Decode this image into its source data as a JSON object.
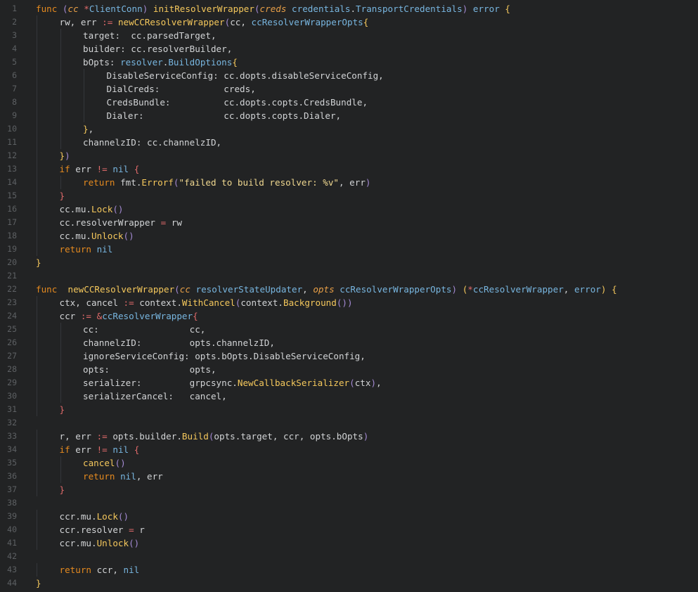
{
  "editor": {
    "lines": [
      {
        "n": "1",
        "indent": 0,
        "tokens": [
          [
            "kw",
            "func "
          ],
          [
            "br",
            "("
          ],
          [
            "param",
            "cc "
          ],
          [
            "op",
            "*"
          ],
          [
            "ty",
            "ClientConn"
          ],
          [
            "br",
            ")"
          ],
          [
            "pl",
            " "
          ],
          [
            "fn",
            "initResolverWrapper"
          ],
          [
            "br",
            "("
          ],
          [
            "param",
            "creds "
          ],
          [
            "ty",
            "credentials"
          ],
          [
            "pl",
            "."
          ],
          [
            "ty",
            "TransportCredentials"
          ],
          [
            "br",
            ")"
          ],
          [
            "pl",
            " "
          ],
          [
            "ty",
            "error"
          ],
          [
            "pl",
            " "
          ],
          [
            "fn",
            "{"
          ]
        ]
      },
      {
        "n": "2",
        "indent": 1,
        "tokens": [
          [
            "pl",
            "rw, err "
          ],
          [
            "op",
            ":="
          ],
          [
            "pl",
            " "
          ],
          [
            "fn",
            "newCCResolverWrapper"
          ],
          [
            "br",
            "("
          ],
          [
            "pl",
            "cc, "
          ],
          [
            "ty",
            "ccResolverWrapperOpts"
          ],
          [
            "fn",
            "{"
          ]
        ]
      },
      {
        "n": "3",
        "indent": 2,
        "tokens": [
          [
            "pl",
            "target:  cc.parsedTarget,"
          ]
        ]
      },
      {
        "n": "4",
        "indent": 2,
        "tokens": [
          [
            "pl",
            "builder: cc.resolverBuilder,"
          ]
        ]
      },
      {
        "n": "5",
        "indent": 2,
        "tokens": [
          [
            "pl",
            "bOpts: "
          ],
          [
            "ty",
            "resolver"
          ],
          [
            "pl",
            "."
          ],
          [
            "ty",
            "BuildOptions"
          ],
          [
            "fn",
            "{"
          ]
        ]
      },
      {
        "n": "6",
        "indent": 3,
        "tokens": [
          [
            "pl",
            "DisableServiceConfig: cc.dopts.disableServiceConfig,"
          ]
        ]
      },
      {
        "n": "7",
        "indent": 3,
        "tokens": [
          [
            "pl",
            "DialCreds:            creds,"
          ]
        ]
      },
      {
        "n": "8",
        "indent": 3,
        "tokens": [
          [
            "pl",
            "CredsBundle:          cc.dopts.copts.CredsBundle,"
          ]
        ]
      },
      {
        "n": "9",
        "indent": 3,
        "tokens": [
          [
            "pl",
            "Dialer:               cc.dopts.copts.Dialer,"
          ]
        ]
      },
      {
        "n": "10",
        "indent": 2,
        "tokens": [
          [
            "fn",
            "}"
          ],
          [
            "pl",
            ","
          ]
        ]
      },
      {
        "n": "11",
        "indent": 2,
        "tokens": [
          [
            "pl",
            "channelzID: cc.channelzID,"
          ]
        ]
      },
      {
        "n": "12",
        "indent": 1,
        "tokens": [
          [
            "fn",
            "}"
          ],
          [
            "br",
            ")"
          ]
        ]
      },
      {
        "n": "13",
        "indent": 1,
        "tokens": [
          [
            "kw",
            "if"
          ],
          [
            "pl",
            " err "
          ],
          [
            "op",
            "!="
          ],
          [
            "pl",
            " "
          ],
          [
            "ty",
            "nil"
          ],
          [
            "pl",
            " "
          ],
          [
            "op",
            "{"
          ]
        ]
      },
      {
        "n": "14",
        "indent": 2,
        "tokens": [
          [
            "kw",
            "return"
          ],
          [
            "pl",
            " fmt."
          ],
          [
            "fn",
            "Errorf"
          ],
          [
            "br",
            "("
          ],
          [
            "str",
            "\"failed to build resolver: %v\""
          ],
          [
            "pl",
            ", err"
          ],
          [
            "br",
            ")"
          ]
        ]
      },
      {
        "n": "15",
        "indent": 1,
        "tokens": [
          [
            "op",
            "}"
          ]
        ]
      },
      {
        "n": "16",
        "indent": 1,
        "tokens": [
          [
            "pl",
            "cc.mu."
          ],
          [
            "fn",
            "Lock"
          ],
          [
            "br",
            "()"
          ]
        ]
      },
      {
        "n": "17",
        "indent": 1,
        "tokens": [
          [
            "pl",
            "cc.resolverWrapper "
          ],
          [
            "op",
            "="
          ],
          [
            "pl",
            " rw"
          ]
        ]
      },
      {
        "n": "18",
        "indent": 1,
        "tokens": [
          [
            "pl",
            "cc.mu."
          ],
          [
            "fn",
            "Unlock"
          ],
          [
            "br",
            "()"
          ]
        ]
      },
      {
        "n": "19",
        "indent": 1,
        "tokens": [
          [
            "kw",
            "return"
          ],
          [
            "pl",
            " "
          ],
          [
            "ty",
            "nil"
          ]
        ]
      },
      {
        "n": "20",
        "indent": 0,
        "tokens": [
          [
            "fn",
            "}"
          ]
        ]
      },
      {
        "n": "21",
        "indent": 0,
        "tokens": []
      },
      {
        "n": "22",
        "indent": 0,
        "tokens": [
          [
            "kw",
            "func "
          ],
          [
            "pl",
            " "
          ],
          [
            "fn",
            "newCCResolverWrapper"
          ],
          [
            "br",
            "("
          ],
          [
            "param",
            "cc "
          ],
          [
            "ty",
            "resolverStateUpdater"
          ],
          [
            "pl",
            ", "
          ],
          [
            "param",
            "opts "
          ],
          [
            "ty",
            "ccResolverWrapperOpts"
          ],
          [
            "br",
            ")"
          ],
          [
            "pl",
            " "
          ],
          [
            "fn",
            "("
          ],
          [
            "op",
            "*"
          ],
          [
            "ty",
            "ccResolverWrapper"
          ],
          [
            "pl",
            ", "
          ],
          [
            "ty",
            "error"
          ],
          [
            "fn",
            ")"
          ],
          [
            "pl",
            " "
          ],
          [
            "fn",
            "{"
          ]
        ]
      },
      {
        "n": "23",
        "indent": 1,
        "tokens": [
          [
            "pl",
            "ctx, cancel "
          ],
          [
            "op",
            ":="
          ],
          [
            "pl",
            " context."
          ],
          [
            "fn",
            "WithCancel"
          ],
          [
            "br",
            "("
          ],
          [
            "pl",
            "context."
          ],
          [
            "fn",
            "Background"
          ],
          [
            "br",
            "())"
          ]
        ]
      },
      {
        "n": "24",
        "indent": 1,
        "tokens": [
          [
            "pl",
            "ccr "
          ],
          [
            "op",
            ":="
          ],
          [
            "pl",
            " "
          ],
          [
            "op",
            "&"
          ],
          [
            "ty",
            "ccResolverWrapper"
          ],
          [
            "op",
            "{"
          ]
        ]
      },
      {
        "n": "25",
        "indent": 2,
        "tokens": [
          [
            "pl",
            "cc:                 cc,"
          ]
        ]
      },
      {
        "n": "26",
        "indent": 2,
        "tokens": [
          [
            "pl",
            "channelzID:         opts.channelzID,"
          ]
        ]
      },
      {
        "n": "27",
        "indent": 2,
        "tokens": [
          [
            "pl",
            "ignoreServiceConfig: opts.bOpts.DisableServiceConfig,"
          ]
        ]
      },
      {
        "n": "28",
        "indent": 2,
        "tokens": [
          [
            "pl",
            "opts:               opts,"
          ]
        ]
      },
      {
        "n": "29",
        "indent": 2,
        "tokens": [
          [
            "pl",
            "serializer:         grpcsync."
          ],
          [
            "fn",
            "NewCallbackSerializer"
          ],
          [
            "br",
            "("
          ],
          [
            "pl",
            "ctx"
          ],
          [
            "br",
            ")"
          ],
          [
            "pl",
            ","
          ]
        ]
      },
      {
        "n": "30",
        "indent": 2,
        "tokens": [
          [
            "pl",
            "serializerCancel:   cancel,"
          ]
        ]
      },
      {
        "n": "31",
        "indent": 1,
        "tokens": [
          [
            "op",
            "}"
          ]
        ]
      },
      {
        "n": "32",
        "indent": 0,
        "tokens": []
      },
      {
        "n": "33",
        "indent": 1,
        "tokens": [
          [
            "pl",
            "r, err "
          ],
          [
            "op",
            ":="
          ],
          [
            "pl",
            " opts.builder."
          ],
          [
            "fn",
            "Build"
          ],
          [
            "br",
            "("
          ],
          [
            "pl",
            "opts.target, ccr, opts.bOpts"
          ],
          [
            "br",
            ")"
          ]
        ]
      },
      {
        "n": "34",
        "indent": 1,
        "tokens": [
          [
            "kw",
            "if"
          ],
          [
            "pl",
            " err "
          ],
          [
            "op",
            "!="
          ],
          [
            "pl",
            " "
          ],
          [
            "ty",
            "nil"
          ],
          [
            "pl",
            " "
          ],
          [
            "op",
            "{"
          ]
        ]
      },
      {
        "n": "35",
        "indent": 2,
        "tokens": [
          [
            "fn",
            "cancel"
          ],
          [
            "br",
            "()"
          ]
        ]
      },
      {
        "n": "36",
        "indent": 2,
        "tokens": [
          [
            "kw",
            "return"
          ],
          [
            "pl",
            " "
          ],
          [
            "ty",
            "nil"
          ],
          [
            "pl",
            ", err"
          ]
        ]
      },
      {
        "n": "37",
        "indent": 1,
        "tokens": [
          [
            "op",
            "}"
          ]
        ]
      },
      {
        "n": "38",
        "indent": 0,
        "tokens": []
      },
      {
        "n": "39",
        "indent": 1,
        "tokens": [
          [
            "pl",
            "ccr.mu."
          ],
          [
            "fn",
            "Lock"
          ],
          [
            "br",
            "()"
          ]
        ]
      },
      {
        "n": "40",
        "indent": 1,
        "tokens": [
          [
            "pl",
            "ccr.resolver "
          ],
          [
            "op",
            "="
          ],
          [
            "pl",
            " r"
          ]
        ]
      },
      {
        "n": "41",
        "indent": 1,
        "tokens": [
          [
            "pl",
            "ccr.mu."
          ],
          [
            "fn",
            "Unlock"
          ],
          [
            "br",
            "()"
          ]
        ]
      },
      {
        "n": "42",
        "indent": 0,
        "tokens": []
      },
      {
        "n": "43",
        "indent": 1,
        "tokens": [
          [
            "kw",
            "return"
          ],
          [
            "pl",
            " ccr, "
          ],
          [
            "ty",
            "nil"
          ]
        ]
      },
      {
        "n": "44",
        "indent": 0,
        "tokens": [
          [
            "fn",
            "}"
          ]
        ]
      }
    ]
  }
}
